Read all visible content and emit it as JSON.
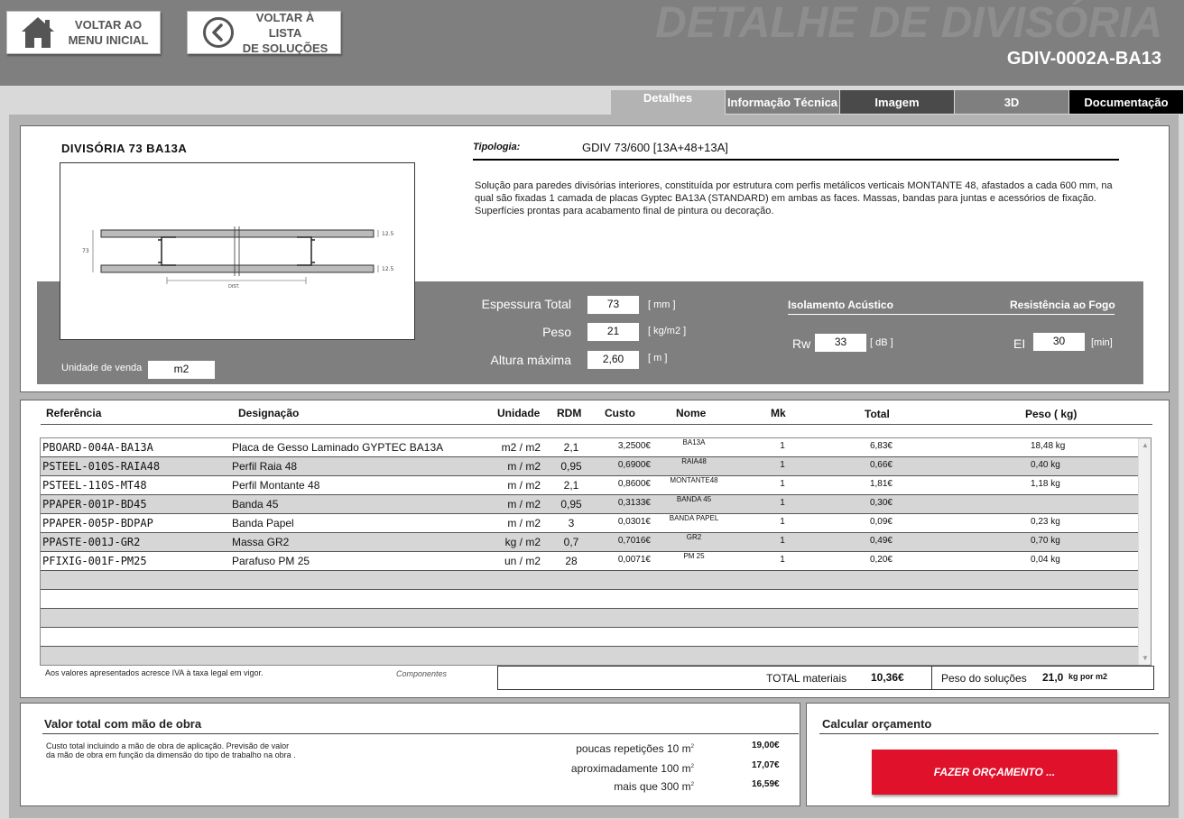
{
  "header": {
    "home_button": {
      "line1": "VOLTAR AO",
      "line2": "MENU INICIAL"
    },
    "back_button": {
      "line1": "VOLTAR À LISTA",
      "line2": "DE SOLUÇÕES"
    },
    "watermark": "DETALHE DE DIVISÓRIA",
    "code": "GDIV-0002A-BA13"
  },
  "tabs": [
    "Detalhes",
    "Informação Técnica",
    "Imagem",
    "3D",
    "Documentação"
  ],
  "product": {
    "name": "DIVISÓRIA 73 BA13A",
    "tipologia_label": "Tipologia:",
    "tipologia_value": "GDIV 73/600 [13A+48+13A]",
    "description": "Solução para paredes divisórias interiores, constituída por estrutura com perfis metálicos verticais MONTANTE 48, afastados a cada 600 mm, na qual são fixadas 1 camada de placas Gyptec BA13A (STANDARD) em ambas as faces. Massas, bandas para juntas e acessórios de fixação. Superfícies prontas para acabamento final de pintura ou decoração.",
    "drawing_labels": {
      "thickness": "73",
      "dim_top": "12.5",
      "dim_bottom": "12.5",
      "dist": "DIST."
    },
    "sale_unit_label": "Unidade de venda",
    "sale_unit_value": "m2"
  },
  "properties": {
    "espessura": {
      "label": "Espessura Total",
      "value": "73",
      "unit": "[ mm ]"
    },
    "peso": {
      "label": "Peso",
      "value": "21",
      "unit": "[ kg/m2 ]"
    },
    "altura": {
      "label": "Altura máxima",
      "value": "2,60",
      "unit": "[ m ]"
    },
    "acoustic": {
      "title": "Isolamento Acústico",
      "label": "Rw",
      "value": "33",
      "unit": "[ dB ]"
    },
    "fire": {
      "title": "Resistência ao Fogo",
      "label": "EI",
      "value": "30",
      "unit": "[min]"
    }
  },
  "table": {
    "headers": [
      "Referência",
      "Designação",
      "Unidade",
      "RDM",
      "Custo",
      "Nome",
      "Mk",
      "Total",
      "Peso ( kg)"
    ],
    "rows": [
      {
        "ref": "PBOARD-004A-BA13A",
        "des": "Placa de Gesso Laminado GYPTEC BA13A",
        "unit": "m2 / m2",
        "rdm": "2,1",
        "custo": "3,2500€",
        "nome": "BA13A",
        "mk": "1",
        "total": "6,83€",
        "peso": "18,48 kg"
      },
      {
        "ref": "PSTEEL-010S-RAIA48",
        "des": "Perfil Raia 48",
        "unit": "m / m2",
        "rdm": "0,95",
        "custo": "0,6900€",
        "nome": "RAIA48",
        "mk": "1",
        "total": "0,66€",
        "peso": "0,40 kg"
      },
      {
        "ref": "PSTEEL-110S-MT48",
        "des": "Perfil Montante 48",
        "unit": "m / m2",
        "rdm": "2,1",
        "custo": "0,8600€",
        "nome": "MONTANTE48",
        "mk": "1",
        "total": "1,81€",
        "peso": "1,18 kg"
      },
      {
        "ref": "PPAPER-001P-BD45",
        "des": "Banda 45",
        "unit": "m / m2",
        "rdm": "0,95",
        "custo": "0,3133€",
        "nome": "BANDA 45",
        "mk": "1",
        "total": "0,30€",
        "peso": ""
      },
      {
        "ref": "PPAPER-005P-BDPAP",
        "des": "Banda Papel",
        "unit": "m / m2",
        "rdm": "3",
        "custo": "0,0301€",
        "nome": "BANDA PAPEL",
        "mk": "1",
        "total": "0,09€",
        "peso": "0,23 kg"
      },
      {
        "ref": "PPASTE-001J-GR2",
        "des": "Massa GR2",
        "unit": "kg / m2",
        "rdm": "0,7",
        "custo": "0,7016€",
        "nome": "GR2",
        "mk": "1",
        "total": "0,49€",
        "peso": "0,70 kg"
      },
      {
        "ref": "PFIXIG-001F-PM25",
        "des": "Parafuso PM 25",
        "unit": "un / m2",
        "rdm": "28",
        "custo": "0,0071€",
        "nome": "PM 25",
        "mk": "1",
        "total": "0,20€",
        "peso": "0,04 kg"
      }
    ],
    "vat_note": "Aos valores apresentados acresce IVA à taxa legal em vigor.",
    "components_label": "Componentes",
    "total_label": "TOTAL materiais",
    "total_value": "10,36€",
    "weight_label": "Peso do soluções",
    "weight_value": "21,0",
    "weight_unit": "kg  por  m2"
  },
  "labor": {
    "title": "Valor total com mão de obra",
    "note": "Custo total incluindo a mão de obra de aplicação. Previsão de valor da mão de obra em função da dimensão do tipo de trabalho na obra .",
    "rows": [
      {
        "label": "poucas repetições  10 m",
        "value": "19,00€"
      },
      {
        "label": "aproximadamente 100 m",
        "value": "17,07€"
      },
      {
        "label": "mais que 300 m",
        "value": "16,59€"
      }
    ]
  },
  "quote": {
    "title": "Calcular orçamento",
    "button": "FAZER ORÇAMENTO ..."
  },
  "colors": {
    "accent": "#e0112b",
    "header": "#7f7f7f"
  }
}
